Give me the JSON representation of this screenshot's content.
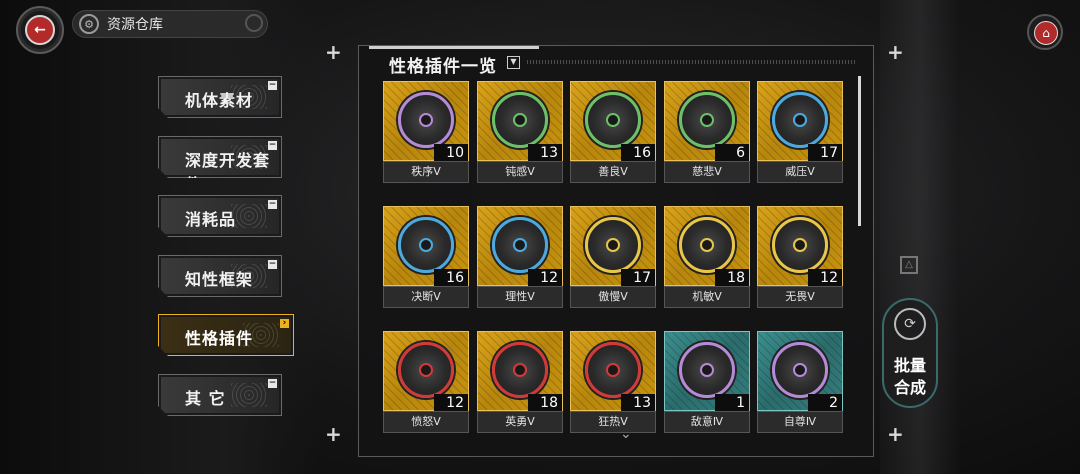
{
  "header": {
    "title": "资源仓库",
    "back_icon": "back-arrow-icon",
    "home_icon": "home-icon"
  },
  "sidebar": {
    "items": [
      {
        "label": "机体素材",
        "marker": "−",
        "active": false
      },
      {
        "label": "深度开发套件",
        "marker": "−",
        "active": false
      },
      {
        "label": "消耗品",
        "marker": "−",
        "active": false
      },
      {
        "label": "知性框架",
        "marker": "−",
        "active": false
      },
      {
        "label": "性格插件",
        "marker": "›",
        "active": true
      },
      {
        "label": "其 它",
        "marker": "−",
        "active": false
      }
    ]
  },
  "panel": {
    "title": "性格插件一览",
    "dropdown_marker": "▼",
    "items": [
      {
        "name": "秩序Ⅴ",
        "count": "10",
        "rarity": "gold",
        "ring": "#b58ad6"
      },
      {
        "name": "钝感Ⅴ",
        "count": "13",
        "rarity": "gold",
        "ring": "#6cc06a"
      },
      {
        "name": "善良Ⅴ",
        "count": "16",
        "rarity": "gold",
        "ring": "#6cc06a"
      },
      {
        "name": "慈悲Ⅴ",
        "count": "6",
        "rarity": "gold",
        "ring": "#6cc06a"
      },
      {
        "name": "威压Ⅴ",
        "count": "17",
        "rarity": "gold",
        "ring": "#4aa9e0"
      },
      {
        "name": "决断Ⅴ",
        "count": "16",
        "rarity": "gold",
        "ring": "#4aa9e0"
      },
      {
        "name": "理性Ⅴ",
        "count": "12",
        "rarity": "gold",
        "ring": "#4aa9e0"
      },
      {
        "name": "傲慢Ⅴ",
        "count": "17",
        "rarity": "gold",
        "ring": "#e8c64a"
      },
      {
        "name": "机敏Ⅴ",
        "count": "18",
        "rarity": "gold",
        "ring": "#e8c64a"
      },
      {
        "name": "无畏Ⅴ",
        "count": "12",
        "rarity": "gold",
        "ring": "#e8c64a"
      },
      {
        "name": "愤怒Ⅴ",
        "count": "12",
        "rarity": "gold",
        "ring": "#d23a3a"
      },
      {
        "name": "英勇Ⅴ",
        "count": "18",
        "rarity": "gold",
        "ring": "#d23a3a"
      },
      {
        "name": "狂热Ⅴ",
        "count": "13",
        "rarity": "gold",
        "ring": "#d23a3a"
      },
      {
        "name": "敌意Ⅳ",
        "count": "1",
        "rarity": "teal",
        "ring": "#b58ad6"
      },
      {
        "name": "自尊Ⅳ",
        "count": "2",
        "rarity": "teal",
        "ring": "#b58ad6"
      }
    ]
  },
  "batch": {
    "line1": "批量",
    "line2": "合成",
    "icon": "synthesis-icon"
  },
  "colors": {
    "accent": "#f0b21a",
    "gold_card": "#d9a21a",
    "teal_card": "#3b8f8e"
  }
}
